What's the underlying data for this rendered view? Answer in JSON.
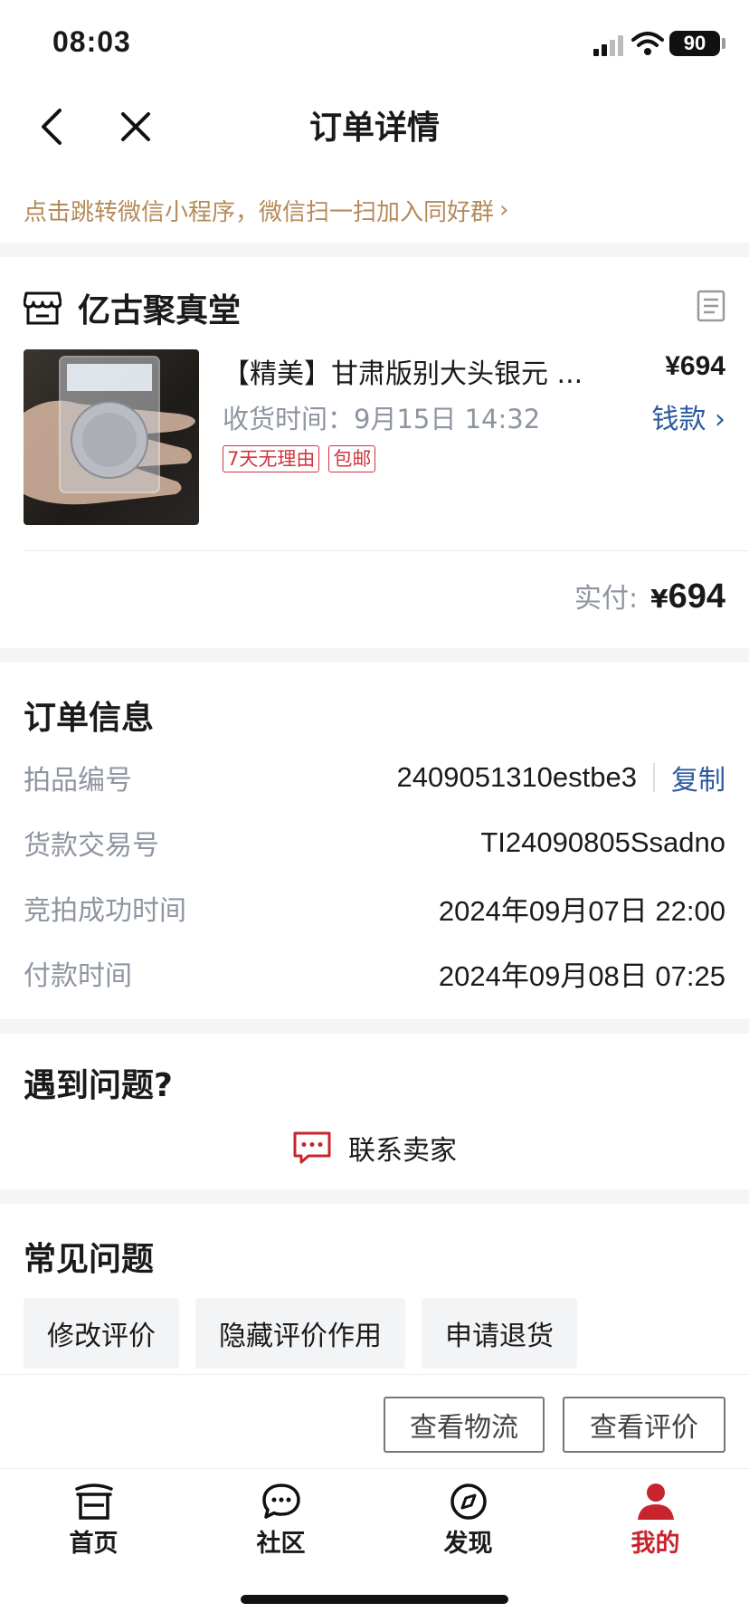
{
  "status": {
    "time": "08:03",
    "battery": "90"
  },
  "nav": {
    "title": "订单详情"
  },
  "banner": {
    "text": "点击跳转微信小程序，微信扫一扫加入同好群",
    "chevron": "›"
  },
  "shop": {
    "name": "亿古聚真堂"
  },
  "product": {
    "title": "【精美】甘肃版别大头银元 ...",
    "price": "¥694",
    "receive_label": "收货时间：",
    "receive_time": "9月15日 14:32",
    "link_label": "钱款 ›",
    "tags": [
      "7天无理由",
      "包邮"
    ]
  },
  "payment": {
    "label": "实付:",
    "yen": "¥",
    "amount": "694"
  },
  "order_info": {
    "title": "订单信息",
    "rows": [
      {
        "label": "拍品编号",
        "value": "2409051310estbe3"
      },
      {
        "label": "货款交易号",
        "value": "TI24090805Ssadno"
      },
      {
        "label": "竞拍成功时间",
        "value": "2024年09月07日 22:00"
      },
      {
        "label": "付款时间",
        "value": "2024年09月08日 07:25"
      }
    ],
    "copy_label": "复制"
  },
  "problem": {
    "title": "遇到问题?",
    "contact_label": "联系卖家"
  },
  "faq": {
    "title": "常见问题",
    "chips": [
      "修改评价",
      "隐藏评价作用",
      "申请退货"
    ]
  },
  "actions": {
    "logistics": "查看物流",
    "review": "查看评价"
  },
  "tabbar": {
    "items": [
      {
        "label": "首页",
        "icon": "home-icon"
      },
      {
        "label": "社区",
        "icon": "chat-icon"
      },
      {
        "label": "发现",
        "icon": "compass-icon"
      },
      {
        "label": "我的",
        "icon": "profile-icon"
      }
    ],
    "active_color": "#c8242e"
  }
}
